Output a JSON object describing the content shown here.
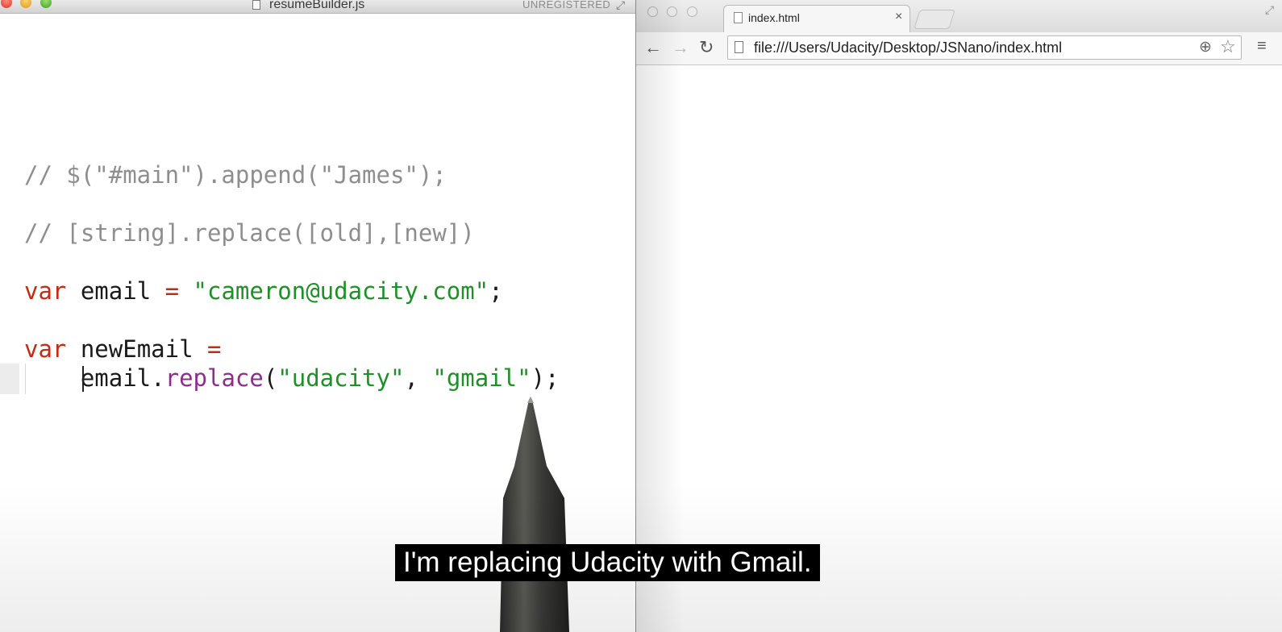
{
  "editor": {
    "title": "resumeBuilder.js",
    "license_status": "UNREGISTERED",
    "code": {
      "line1": "// $(\"#main\").append(\"James\");",
      "line2": "// [string].replace([old],[new])",
      "line3": {
        "kw": "var",
        "name": " email ",
        "op": "=",
        "str": " \"cameron@udacity.com\"",
        "end": ";"
      },
      "line4": {
        "kw": "var",
        "name": " newEmail ",
        "op": "="
      },
      "line5": {
        "indent": "    ",
        "obj": "email.",
        "fn": "replace",
        "open": "(",
        "arg1": "\"udacity\"",
        "sep": ", ",
        "arg2": "\"gmail\"",
        "end": ");"
      }
    }
  },
  "browser": {
    "tab_title": "index.html",
    "tab_close": "×",
    "url": "file:///Users/Udacity/Desktop/JSNano/index.html",
    "back": "←",
    "forward": "→",
    "reload": "↻",
    "zoom": "⊕",
    "star": "☆",
    "menu": "≡"
  },
  "subtitle": "I'm replacing Udacity with Gmail.",
  "colors": {
    "keyword": "#c22b14",
    "string": "#1f8f27",
    "function": "#8a2e8a",
    "comment": "#8e8e8e"
  },
  "icons": {
    "editor": [
      "close-icon",
      "minimize-icon",
      "zoom-icon",
      "file-icon",
      "resize-icon"
    ],
    "browser": [
      "page-icon",
      "close-icon",
      "back-arrow-icon",
      "forward-arrow-icon",
      "reload-icon",
      "zoom-icon",
      "star-icon",
      "menu-icon"
    ]
  }
}
